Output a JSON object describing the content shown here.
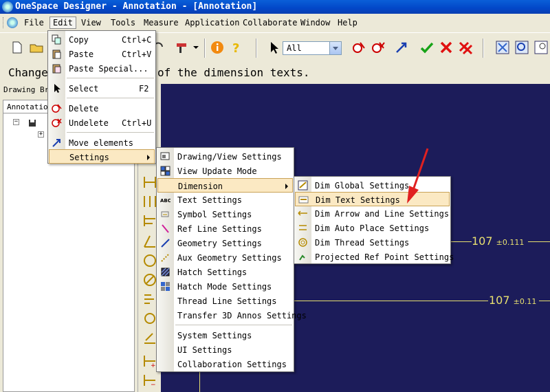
{
  "window": {
    "title": "OneSpace Designer - Annotation - [Annotation]"
  },
  "menubar": {
    "items": [
      {
        "label": "File"
      },
      {
        "label": "Edit"
      },
      {
        "label": "View"
      },
      {
        "label": "Tools"
      },
      {
        "label": "Measure"
      },
      {
        "label": "Application"
      },
      {
        "label": "Collaborate"
      },
      {
        "label": "Window"
      },
      {
        "label": "Help"
      }
    ]
  },
  "toolbar": {
    "filter_value": "All"
  },
  "prompt": {
    "text_left": "Change",
    "text_right": "of the dimension texts."
  },
  "browser": {
    "header": "Drawing Bro",
    "tab": "Annotation"
  },
  "edit_menu": {
    "items": [
      {
        "label": "Copy",
        "shortcut": "Ctrl+C",
        "icon": "copy-icon"
      },
      {
        "label": "Paste",
        "shortcut": "Ctrl+V",
        "icon": "paste-icon"
      },
      {
        "label": "Paste Special...",
        "shortcut": "",
        "icon": "paste-special-icon"
      },
      {
        "label": "Select",
        "shortcut": "F2",
        "icon": "select-arrow-icon"
      },
      {
        "label": "Delete",
        "shortcut": "",
        "icon": "delete-icon"
      },
      {
        "label": "Undelete",
        "shortcut": "Ctrl+U",
        "icon": "undelete-icon"
      },
      {
        "label": "Move elements",
        "shortcut": "",
        "icon": "move-icon"
      },
      {
        "label": "Settings",
        "shortcut": "",
        "icon": "settings-icon"
      }
    ]
  },
  "settings_menu": {
    "items": [
      {
        "label": "Drawing/View Settings"
      },
      {
        "label": "View Update Mode"
      },
      {
        "label": "Dimension"
      },
      {
        "label": "Text Settings"
      },
      {
        "label": "Symbol Settings"
      },
      {
        "label": "Ref Line Settings"
      },
      {
        "label": "Geometry Settings"
      },
      {
        "label": "Aux Geometry Settings"
      },
      {
        "label": "Hatch Settings"
      },
      {
        "label": "Hatch Mode Settings"
      },
      {
        "label": "Thread Line Settings"
      },
      {
        "label": "Transfer 3D Annos Settings"
      },
      {
        "label": "System Settings"
      },
      {
        "label": "UI Settings"
      },
      {
        "label": "Collaboration Settings"
      }
    ]
  },
  "dimension_menu": {
    "items": [
      {
        "label": "Dim Global Settings"
      },
      {
        "label": "Dim Text Settings"
      },
      {
        "label": "Dim Arrow and Line Settings"
      },
      {
        "label": "Dim Auto Place Settings"
      },
      {
        "label": "Dim Thread Settings"
      },
      {
        "label": "Projected Ref Point Settings"
      }
    ]
  },
  "canvas": {
    "dim1": {
      "value": "107",
      "tol": "±0.111"
    },
    "dim2": {
      "value": "107",
      "tol": "±0.11"
    }
  },
  "colors": {
    "canvas_bg": "#1c1c5a",
    "dim_color": "#e8e070",
    "highlight": "#fbe9c3",
    "arrow": "#e02020"
  }
}
